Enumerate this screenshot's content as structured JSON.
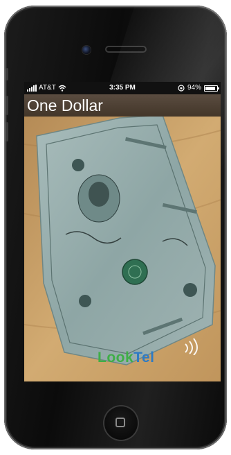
{
  "status_bar": {
    "carrier": "AT&T",
    "time": "3:35 PM",
    "battery": "94%"
  },
  "app": {
    "title": "One Dollar"
  },
  "logo": {
    "part1": "Look",
    "part2": "Tel"
  },
  "colors": {
    "title_bar": "#4d4034",
    "bill": "#8fa8a6",
    "logo_green": "#3fae47",
    "logo_blue": "#2e7bc4"
  }
}
